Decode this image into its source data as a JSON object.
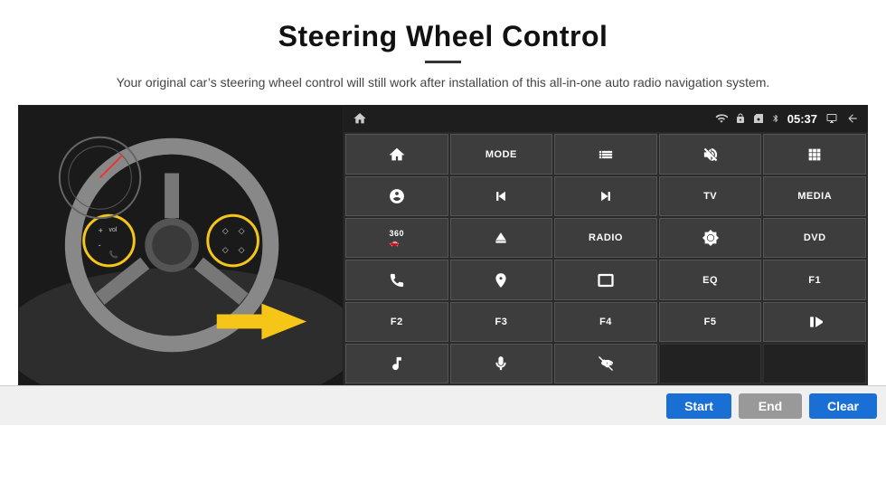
{
  "page": {
    "title": "Steering Wheel Control",
    "subtitle": "Your original car’s steering wheel control will still work after installation of this all-in-one auto radio navigation system."
  },
  "status_bar": {
    "time": "05:37",
    "icons": [
      "wifi",
      "lock",
      "sim",
      "bluetooth",
      "screen",
      "back"
    ]
  },
  "grid_buttons": [
    {
      "id": "r1c1",
      "type": "icon",
      "icon": "home"
    },
    {
      "id": "r1c2",
      "type": "text",
      "label": "MODE"
    },
    {
      "id": "r1c3",
      "type": "icon",
      "icon": "list"
    },
    {
      "id": "r1c4",
      "type": "icon",
      "icon": "mute"
    },
    {
      "id": "r1c5",
      "type": "icon",
      "icon": "apps"
    },
    {
      "id": "r2c1",
      "type": "icon",
      "icon": "settings-circle"
    },
    {
      "id": "r2c2",
      "type": "icon",
      "icon": "prev"
    },
    {
      "id": "r2c3",
      "type": "icon",
      "icon": "next"
    },
    {
      "id": "r2c4",
      "type": "text",
      "label": "TV"
    },
    {
      "id": "r2c5",
      "type": "text",
      "label": "MEDIA"
    },
    {
      "id": "r3c1",
      "type": "icon",
      "icon": "360-cam"
    },
    {
      "id": "r3c2",
      "type": "icon",
      "icon": "eject"
    },
    {
      "id": "r3c3",
      "type": "text",
      "label": "RADIO"
    },
    {
      "id": "r3c4",
      "type": "icon",
      "icon": "brightness"
    },
    {
      "id": "r3c5",
      "type": "text",
      "label": "DVD"
    },
    {
      "id": "r4c1",
      "type": "icon",
      "icon": "phone"
    },
    {
      "id": "r4c2",
      "type": "icon",
      "icon": "nav"
    },
    {
      "id": "r4c3",
      "type": "icon",
      "icon": "screen-mirror"
    },
    {
      "id": "r4c4",
      "type": "text",
      "label": "EQ"
    },
    {
      "id": "r4c5",
      "type": "text",
      "label": "F1"
    },
    {
      "id": "r5c1",
      "type": "text",
      "label": "F2"
    },
    {
      "id": "r5c2",
      "type": "text",
      "label": "F3"
    },
    {
      "id": "r5c3",
      "type": "text",
      "label": "F4"
    },
    {
      "id": "r5c4",
      "type": "text",
      "label": "F5"
    },
    {
      "id": "r5c5",
      "type": "icon",
      "icon": "play-pause"
    },
    {
      "id": "r6c1",
      "type": "icon",
      "icon": "music"
    },
    {
      "id": "r6c2",
      "type": "icon",
      "icon": "mic"
    },
    {
      "id": "r6c3",
      "type": "icon",
      "icon": "call-end"
    },
    {
      "id": "r6c4",
      "type": "empty"
    },
    {
      "id": "r6c5",
      "type": "empty"
    }
  ],
  "action_bar": {
    "start_label": "Start",
    "end_label": "End",
    "clear_label": "Clear"
  }
}
